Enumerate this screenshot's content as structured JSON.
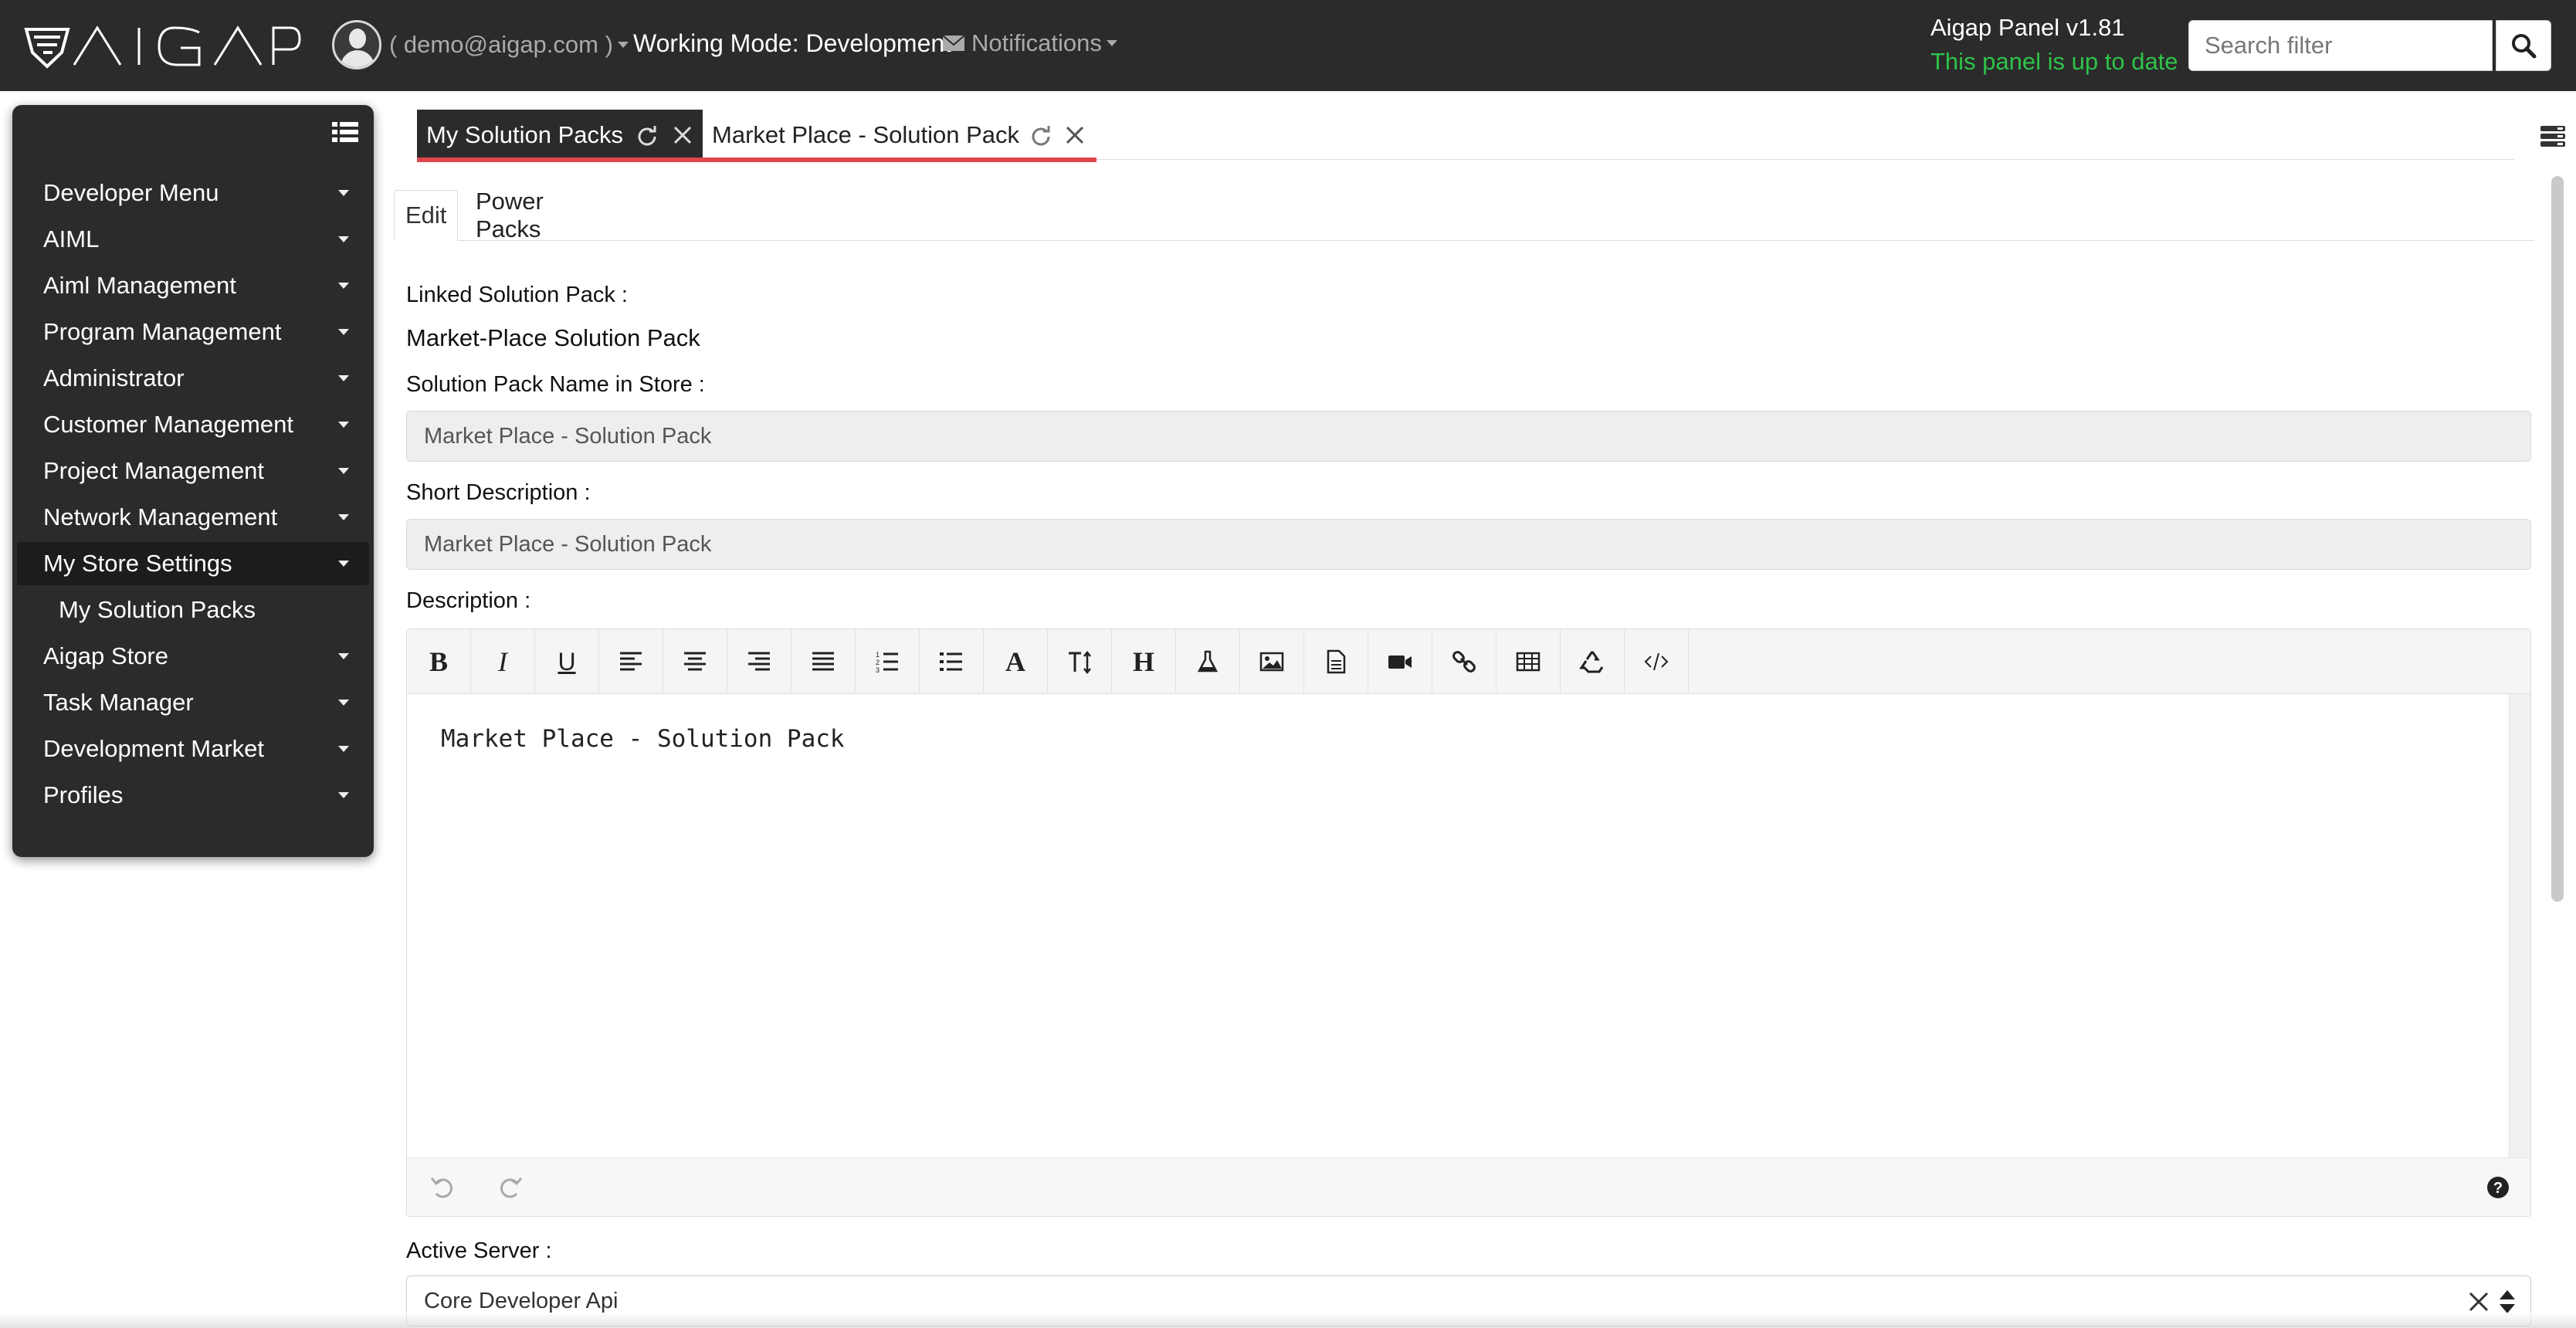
{
  "header": {
    "brand": "AIGAP",
    "user_email": "( demo@aigap.com )",
    "working_mode": "Working Mode: Development",
    "notifications_label": "Notifications",
    "panel_version": "Aigap Panel v1.81",
    "panel_status": "This panel is up to date",
    "search_placeholder": "Search filter",
    "status_color": "#2fc34a"
  },
  "sidebar": {
    "items": [
      {
        "label": "Developer Menu"
      },
      {
        "label": "AIML"
      },
      {
        "label": "Aiml Management"
      },
      {
        "label": "Program Management"
      },
      {
        "label": "Administrator"
      },
      {
        "label": "Customer Management"
      },
      {
        "label": "Project Management"
      },
      {
        "label": "Network Management"
      },
      {
        "label": "My Store Settings",
        "active": true
      },
      {
        "label": "My Solution Packs",
        "sub": true
      },
      {
        "label": "Aigap Store"
      },
      {
        "label": "Task Manager"
      },
      {
        "label": "Development Market"
      },
      {
        "label": "Profiles"
      }
    ]
  },
  "page_tabs": [
    {
      "label": "My Solution Packs",
      "active": true
    },
    {
      "label": "Market Place - Solution Pack",
      "active": false
    }
  ],
  "sub_tabs": [
    {
      "label": "Edit",
      "active": true
    },
    {
      "label": "Power Packs",
      "active": false
    }
  ],
  "form": {
    "linked_label": "Linked Solution Pack :",
    "linked_value": "Market-Place Solution Pack",
    "name_label": "Solution Pack Name in Store :",
    "name_value": "Market Place - Solution Pack",
    "short_desc_label": "Short Description :",
    "short_desc_value": "Market Place - Solution Pack",
    "description_label": "Description :",
    "editor_content": "Market Place - Solution Pack",
    "toolbar_icons": [
      "bold-icon",
      "italic-icon",
      "underline-icon",
      "align-left-icon",
      "align-center-icon",
      "align-right-icon",
      "align-justify-icon",
      "ordered-list-icon",
      "unordered-list-icon",
      "font-color-icon",
      "font-size-icon",
      "heading-icon",
      "flask-icon",
      "image-icon",
      "document-icon",
      "video-icon",
      "link-icon",
      "table-icon",
      "recycle-icon",
      "code-view-icon"
    ],
    "active_server_label": "Active Server :",
    "active_server_value": "Core Developer Api"
  },
  "accent_color": "#e0474c"
}
